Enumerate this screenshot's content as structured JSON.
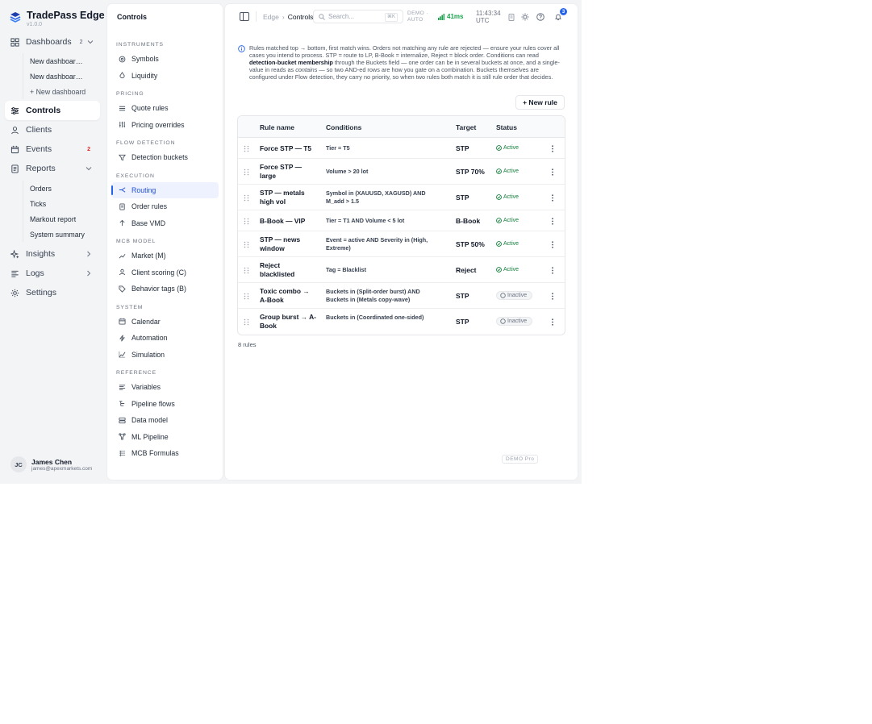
{
  "brand": {
    "name": "TradePass Edge",
    "version": "v1.0.0"
  },
  "nav": {
    "dashboards": {
      "label": "Dashboards",
      "badge": "2"
    },
    "dashboard_children": [
      "New dashboar…",
      "New dashboar…",
      "+ New dashboard"
    ],
    "controls": "Controls",
    "clients": "Clients",
    "events": {
      "label": "Events",
      "badge": "2"
    },
    "reports": "Reports",
    "report_children": [
      "Orders",
      "Ticks",
      "Markout report",
      "System summary"
    ],
    "insights": "Insights",
    "logs": "Logs",
    "settings": "Settings"
  },
  "user": {
    "initials": "JC",
    "name": "James Chen",
    "email": "james@apexmarkets.com"
  },
  "panel": {
    "title": "Controls",
    "sections": [
      {
        "label": "INSTRUMENTS",
        "items": [
          {
            "label": "Symbols",
            "icon": "settings-icon"
          },
          {
            "label": "Liquidity",
            "icon": "droplet-icon"
          }
        ]
      },
      {
        "label": "PRICING",
        "items": [
          {
            "label": "Quote rules",
            "icon": "list-icon"
          },
          {
            "label": "Pricing overrides",
            "icon": "sliders-icon"
          }
        ]
      },
      {
        "label": "FLOW DETECTION",
        "items": [
          {
            "label": "Detection buckets",
            "icon": "filter-icon"
          }
        ]
      },
      {
        "label": "EXECUTION",
        "items": [
          {
            "label": "Routing",
            "icon": "routing-icon",
            "active": true
          },
          {
            "label": "Order rules",
            "icon": "document-icon"
          },
          {
            "label": "Base VMD",
            "icon": "arrow-up-icon"
          }
        ]
      },
      {
        "label": "MCB MODEL",
        "items": [
          {
            "label": "Market (M)",
            "icon": "trend-icon"
          },
          {
            "label": "Client scoring (C)",
            "icon": "user-icon"
          },
          {
            "label": "Behavior tags (B)",
            "icon": "tag-icon"
          }
        ]
      },
      {
        "label": "SYSTEM",
        "items": [
          {
            "label": "Calendar",
            "icon": "calendar-icon"
          },
          {
            "label": "Automation",
            "icon": "bolt-icon"
          },
          {
            "label": "Simulation",
            "icon": "chart-icon"
          }
        ]
      },
      {
        "label": "REFERENCE",
        "items": [
          {
            "label": "Variables",
            "icon": "variables-icon"
          },
          {
            "label": "Pipeline flows",
            "icon": "flow-icon"
          },
          {
            "label": "Data model",
            "icon": "database-icon"
          },
          {
            "label": "ML Pipeline",
            "icon": "ml-icon"
          },
          {
            "label": "MCB Formulas",
            "icon": "formula-icon"
          }
        ]
      }
    ]
  },
  "topbar": {
    "breadcrumb": [
      "Edge",
      "Controls"
    ],
    "search_placeholder": "Search...",
    "shortcut": "⌘K",
    "mode": [
      "DEMO ·",
      "AUTO"
    ],
    "latency": "41ms",
    "time": [
      "11:43:34",
      "UTC"
    ],
    "notifications": "3"
  },
  "info": {
    "p1": "Rules matched top → bottom, first match wins. Orders not matching any rule are rejected — ensure your rules cover all cases you intend to process. STP = route to LP, B-Book = internalize, Reject = block order. Conditions can read ",
    "b1": "detection-bucket membership",
    "p2": " through the Buckets field — one order can be in several buckets at once, and a single-value in reads as ",
    "i1": "contains",
    "p3": " — so two AND-ed rows are how you gate on a combination. Buckets themselves are configured under Flow detection, they carry no priority, so when two rules both match it is still rule order that decides."
  },
  "new_rule_label": "+ New rule",
  "table": {
    "headers": [
      "Rule name",
      "Conditions",
      "Target",
      "Status"
    ],
    "rows": [
      {
        "name": "Force STP — T5",
        "cond": "Tier = T5",
        "target": "STP",
        "status": "Active"
      },
      {
        "name": "Force STP — large",
        "cond": "Volume > 20 lot",
        "target": "STP 70%",
        "status": "Active"
      },
      {
        "name": "STP — metals high vol",
        "cond": "Symbol in (XAUUSD, XAGUSD) AND M_add > 1.5",
        "target": "STP",
        "status": "Active"
      },
      {
        "name": "B-Book — VIP",
        "cond": "Tier = T1 AND Volume < 5 lot",
        "target": "B-Book",
        "status": "Active"
      },
      {
        "name": "STP — news window",
        "cond": "Event = active AND Severity in (High, Extreme)",
        "target": "STP 50%",
        "status": "Active"
      },
      {
        "name": "Reject blacklisted",
        "cond": "Tag = Blacklist",
        "target": "Reject",
        "status": "Active"
      },
      {
        "name": "Toxic combo → A-Book",
        "cond": "Buckets in (Split-order burst) AND Buckets in (Metals copy-wave)",
        "target": "STP",
        "status": "Inactive"
      },
      {
        "name": "Group burst → A-Book",
        "cond": "Buckets in (Coordinated one-sided)",
        "target": "STP",
        "status": "Inactive"
      }
    ],
    "count": "8 rules"
  },
  "footer_tag": "DEMO Pro",
  "colors": {
    "accent": "#2563eb",
    "active": "#15803d",
    "danger": "#dc2626"
  }
}
